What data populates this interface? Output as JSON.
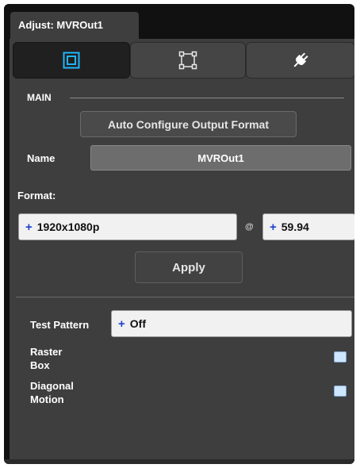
{
  "header": {
    "tab_title": "Adjust: MVROut1"
  },
  "toolbar": {
    "icons": [
      {
        "name": "output-monitor-icon",
        "active": true
      },
      {
        "name": "crop-frame-icon",
        "active": false
      },
      {
        "name": "plug-icon",
        "active": false
      }
    ]
  },
  "main": {
    "section_label": "MAIN",
    "auto_configure_label": "Auto Configure Output Format",
    "name_label": "Name",
    "name_value": "MVROut1",
    "format_label": "Format:",
    "format": {
      "resolution": "1920x1080p",
      "at_symbol": "@",
      "frame_rate": "59.94",
      "plus": "+"
    },
    "apply_label": "Apply"
  },
  "test": {
    "test_pattern_label": "Test Pattern",
    "test_pattern_value": "Off",
    "raster_box_label_line1": "Raster",
    "raster_box_label_line2": "Box",
    "diagonal_motion_label_line1": "Diagonal",
    "diagonal_motion_label_line2": "Motion"
  },
  "colors": {
    "panel_bg": "#3e3e3e",
    "accent_blue": "#1d3fd1",
    "icon_cyan": "#1fb6ff",
    "checkbox_fill": "#cfe6ff"
  }
}
